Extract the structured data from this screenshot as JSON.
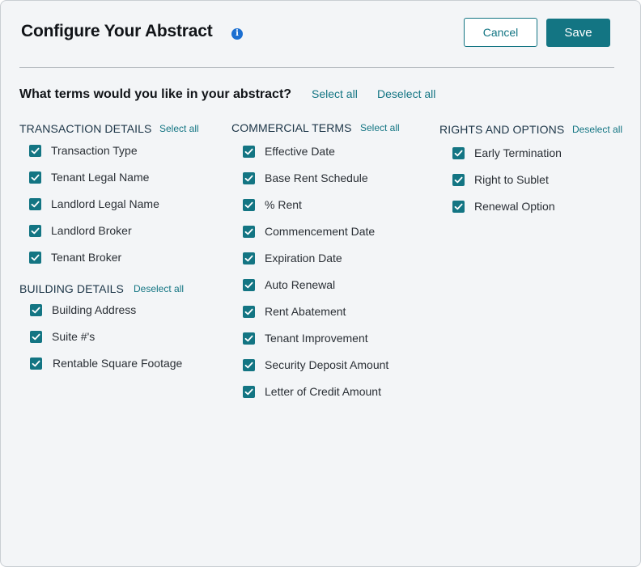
{
  "header": {
    "title": "Configure Your Abstract",
    "info_icon": "info-icon",
    "cancel_label": "Cancel",
    "save_label": "Save"
  },
  "prompt": {
    "question": "What terms would you like in your abstract?",
    "select_all": "Select all",
    "deselect_all": "Deselect all"
  },
  "sections": {
    "transaction": {
      "title": "TRANSACTION DETAILS",
      "action": "Select all",
      "items": [
        {
          "label": "Transaction Type",
          "checked": true
        },
        {
          "label": "Tenant Legal Name",
          "checked": true
        },
        {
          "label": "Landlord Legal Name",
          "checked": true
        },
        {
          "label": "Landlord Broker",
          "checked": true
        },
        {
          "label": "Tenant Broker",
          "checked": true
        }
      ]
    },
    "building": {
      "title": "BUILDING DETAILS",
      "action": "Deselect all",
      "items": [
        {
          "label": "Building Address",
          "checked": true
        },
        {
          "label": "Suite #'s",
          "checked": true
        },
        {
          "label": "Rentable Square Footage",
          "checked": true
        }
      ]
    },
    "commercial": {
      "title": "COMMERCIAL TERMS",
      "action": "Select all",
      "items": [
        {
          "label": "Effective Date",
          "checked": true
        },
        {
          "label": "Base Rent Schedule",
          "checked": true
        },
        {
          "label": "% Rent",
          "checked": true
        },
        {
          "label": "Commencement Date",
          "checked": true
        },
        {
          "label": "Expiration Date",
          "checked": true
        },
        {
          "label": "Auto Renewal",
          "checked": true
        },
        {
          "label": "Rent Abatement",
          "checked": true
        },
        {
          "label": "Tenant Improvement",
          "checked": true
        },
        {
          "label": "Security Deposit Amount",
          "checked": true
        },
        {
          "label": "Letter of Credit Amount",
          "checked": true
        }
      ]
    },
    "rights": {
      "title": "RIGHTS AND OPTIONS",
      "action": "Deselect all",
      "items": [
        {
          "label": "Early Termination",
          "checked": true
        },
        {
          "label": "Right to Sublet",
          "checked": true
        },
        {
          "label": "Renewal Option",
          "checked": true
        }
      ]
    }
  },
  "colors": {
    "accent": "#137583",
    "background": "#f3f5f7",
    "info": "#1b6fd1"
  }
}
